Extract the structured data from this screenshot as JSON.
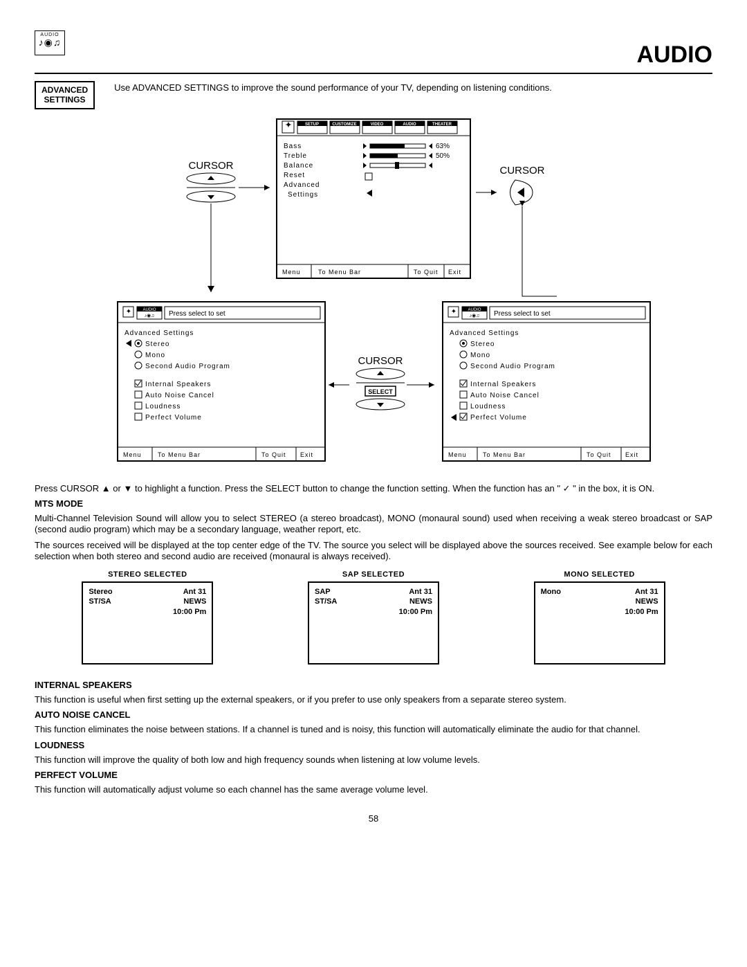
{
  "header": {
    "icon_label": "AUDIO",
    "page_title": "AUDIO"
  },
  "adv_box": {
    "line1": "ADVANCED",
    "line2": "SETTINGS"
  },
  "intro": "Use ADVANCED SETTINGS to improve the sound performance of your TV, depending on listening conditions.",
  "diagram": {
    "top_tabs": [
      "SETUP",
      "CUSTOMIZE",
      "VIDEO",
      "AUDIO",
      "THEATER"
    ],
    "cursor_left": "CURSOR",
    "cursor_right": "CURSOR",
    "cursor_mid": "CURSOR",
    "select_btn": "SELECT",
    "main_menu": {
      "items": [
        "Bass",
        "Treble",
        "Balance",
        "Reset",
        "Advanced",
        "  Settings"
      ],
      "bass_pct": "63%",
      "treble_pct": "50%",
      "footer": {
        "menu": "Menu",
        "bar": "To Menu Bar",
        "quit": "To Quit",
        "exit": "Exit"
      }
    },
    "sub_left": {
      "header_icon": "AUDIO",
      "press": "Press select to set",
      "title": "Advanced Settings",
      "opts": [
        "Stereo",
        "Mono",
        "Second Audio Program"
      ],
      "items": [
        "Internal Speakers",
        "Auto Noise Cancel",
        "Loudness",
        "Perfect Volume"
      ],
      "footer": {
        "menu": "Menu",
        "bar": "To Menu Bar",
        "quit": "To Quit",
        "exit": "Exit"
      }
    },
    "sub_right": {
      "header_icon": "AUDIO",
      "press": "Press select to set",
      "title": "Advanced Settings",
      "opts": [
        "Stereo",
        "Mono",
        "Second Audio Program"
      ],
      "items": [
        "Internal Speakers",
        "Auto Noise Cancel",
        "Loudness",
        "Perfect Volume"
      ],
      "footer": {
        "menu": "Menu",
        "bar": "To Menu Bar",
        "quit": "To Quit",
        "exit": "Exit"
      }
    }
  },
  "para1_a": "Press CURSOR ",
  "para1_b": " or ",
  "para1_c": " to highlight a function. Press the SELECT button to change the function setting. When the function has an \" ",
  "para1_d": " \" in the box, it is ON.",
  "mts": {
    "heading": "MTS MODE",
    "p1": "Multi-Channel Television Sound will allow you to select STEREO (a stereo broadcast), MONO (monaural sound) used when receiving a weak stereo broadcast or SAP (second audio program) which may be a secondary language, weather report, etc.",
    "p2": "The sources received will be displayed at the top center edge of the TV.  The source you select will be displayed above the sources received.  See example below for each selection when both stereo and second audio are received (monaural is always received)."
  },
  "selections": {
    "stereo": {
      "label": "STEREO SELECTED",
      "l1": "Stereo",
      "l2": "ST/SA",
      "r1": "Ant   31",
      "r2": "NEWS",
      "r3": "10:00 Pm"
    },
    "sap": {
      "label": "SAP SELECTED",
      "l1": "SAP",
      "l2": "ST/SA",
      "r1": "Ant   31",
      "r2": "NEWS",
      "r3": "10:00 Pm"
    },
    "mono": {
      "label": "MONO SELECTED",
      "l1": "Mono",
      "l2": "",
      "r1": "Ant   31",
      "r2": "NEWS",
      "r3": "10:00 Pm"
    }
  },
  "sections": {
    "int": {
      "h": "INTERNAL SPEAKERS",
      "t": "This function is useful when first setting up the external speakers, or if you prefer to use only speakers from a separate stereo system."
    },
    "anc": {
      "h": "AUTO NOISE CANCEL",
      "t": "This function eliminates the noise between stations. If a channel is tuned and is noisy, this function will automatically eliminate the audio for that channel."
    },
    "loud": {
      "h": "LOUDNESS",
      "t": "This function will improve the quality of both low and high frequency sounds when listening at low volume levels."
    },
    "pv": {
      "h": "PERFECT VOLUME",
      "t": "This function will automatically adjust volume so each channel has the same average volume level."
    }
  },
  "page_number": "58",
  "chart_data": {
    "type": "table",
    "title": "Audio menu sliders",
    "rows": [
      {
        "setting": "Bass",
        "value_pct": 63
      },
      {
        "setting": "Treble",
        "value_pct": 50
      }
    ]
  }
}
